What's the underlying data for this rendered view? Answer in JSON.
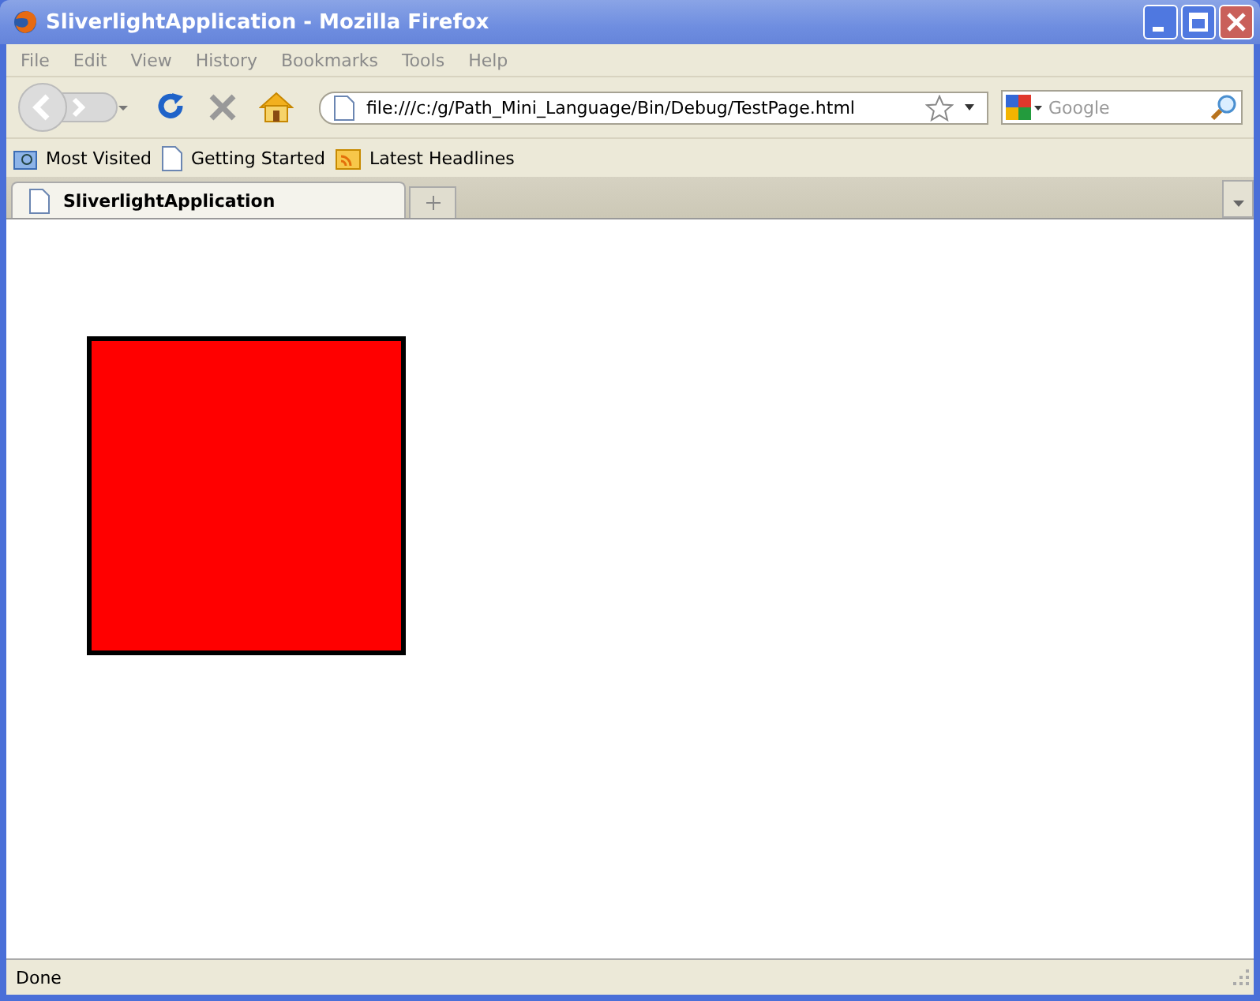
{
  "window": {
    "title": "SliverlightApplication - Mozilla Firefox"
  },
  "menu": [
    "File",
    "Edit",
    "View",
    "History",
    "Bookmarks",
    "Tools",
    "Help"
  ],
  "address_bar": {
    "value": "file:///c:/g/Path_Mini_Language/Bin/Debug/TestPage.html"
  },
  "search": {
    "placeholder": "Google"
  },
  "bookmarks": [
    {
      "label": "Most Visited",
      "kind": "folder"
    },
    {
      "label": "Getting Started",
      "kind": "page"
    },
    {
      "label": "Latest Headlines",
      "kind": "feed"
    }
  ],
  "tabs": [
    {
      "label": "SliverlightApplication",
      "selected": true
    }
  ],
  "status_bar": {
    "text": "Done"
  }
}
